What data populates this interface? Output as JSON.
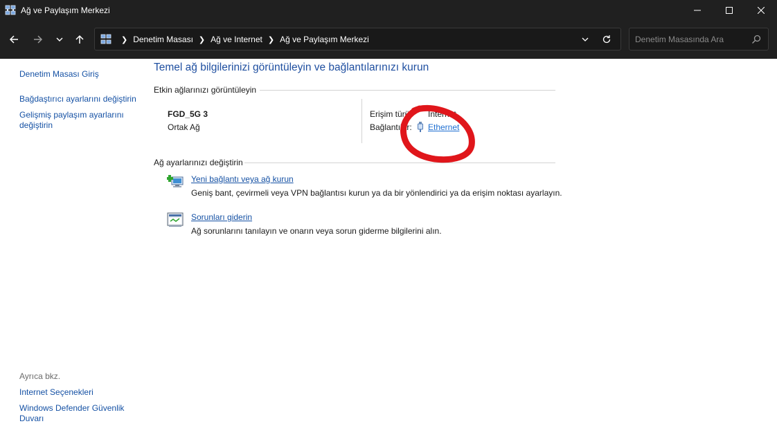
{
  "window": {
    "title": "Ağ ve Paylaşım Merkezi",
    "icon": "network-control-panel-icon"
  },
  "nav": {
    "back_icon": "arrow-left-icon",
    "forward_icon": "arrow-right-icon",
    "recent_icon": "chevron-down-icon",
    "up_icon": "arrow-up-icon"
  },
  "address": {
    "crumbs": [
      "Denetim Masası",
      "Ağ ve Internet",
      "Ağ ve Paylaşım Merkezi"
    ],
    "search_placeholder": "Denetim Masasında Ara"
  },
  "sidebar": {
    "items": [
      {
        "label": "Denetim Masası Giriş"
      },
      {
        "label": "Bağdaştırıcı ayarlarını değiştirin"
      },
      {
        "label": "Gelişmiş paylaşım ayarlarını değiştirin"
      }
    ],
    "see_also": {
      "title": "Ayrıca bkz.",
      "items": [
        {
          "label": "Internet Seçenekleri"
        },
        {
          "label": "Windows Defender Güvenlik Duvarı"
        }
      ]
    }
  },
  "main": {
    "title": "Temel ağ bilgilerinizi görüntüleyin ve bağlantılarınızı kurun",
    "active_networks": {
      "heading": "Etkin ağlarınızı görüntüleyin",
      "network_name": "FGD_5G 3",
      "network_type": "Ortak Ağ",
      "access_label": "Erişim türü:",
      "access_value": "Internet",
      "connections_label": "Bağlantılar:",
      "connection_value": "Ethernet"
    },
    "change_settings": {
      "heading": "Ağ ayarlarınızı değiştirin",
      "tasks": [
        {
          "label": "Yeni bağlantı veya ağ kurun",
          "desc": "Geniş bant, çevirmeli veya VPN bağlantısı kurun ya da bir yönlendirici ya da erişim noktası ayarlayın.",
          "icon": "new-connection-icon"
        },
        {
          "label": "Sorunları giderin",
          "desc": "Ağ sorunlarını tanılayın ve onarın veya sorun giderme bilgilerini alın.",
          "icon": "troubleshoot-icon"
        }
      ]
    }
  },
  "colors": {
    "titlebar": "#202020",
    "link": "#1551a4",
    "title_blue": "#1f4fa0",
    "annotation": "#e0161b"
  }
}
